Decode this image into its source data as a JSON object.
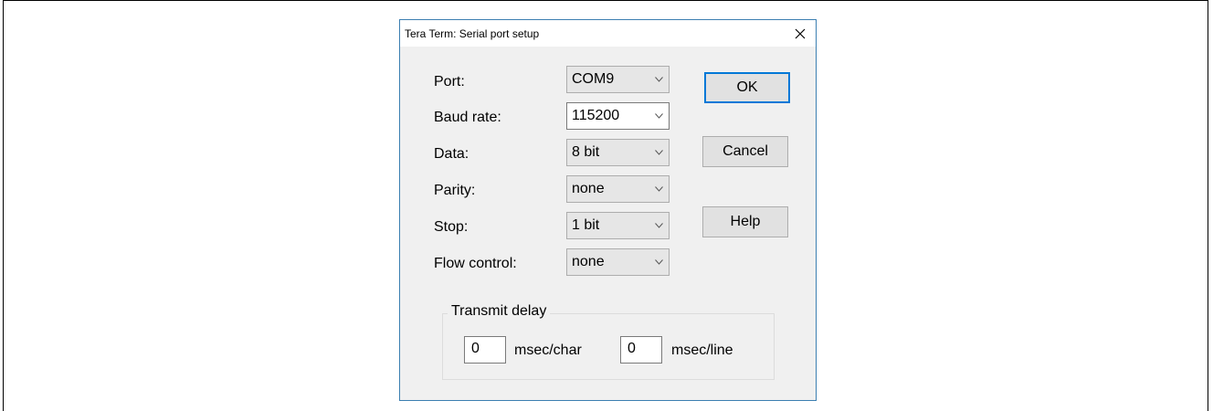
{
  "dialog": {
    "title": "Tera Term: Serial port setup",
    "close_icon": "close-icon"
  },
  "fields": {
    "port": {
      "label": "Port:",
      "value": "COM9"
    },
    "baud_rate": {
      "label": "Baud rate:",
      "value": "115200"
    },
    "data": {
      "label": "Data:",
      "value": "8 bit"
    },
    "parity": {
      "label": "Parity:",
      "value": "none"
    },
    "stop": {
      "label": "Stop:",
      "value": "1 bit"
    },
    "flow_control": {
      "label": "Flow control:",
      "value": "none"
    }
  },
  "buttons": {
    "ok": "OK",
    "cancel": "Cancel",
    "help": "Help"
  },
  "transmit_delay": {
    "title": "Transmit delay",
    "char_value": "0",
    "char_unit": "msec/char",
    "line_value": "0",
    "line_unit": "msec/line"
  },
  "colors": {
    "dialog_border": "#3c7fb1",
    "dialog_bg": "#f0f0f0",
    "default_button_border": "#0078d7"
  }
}
